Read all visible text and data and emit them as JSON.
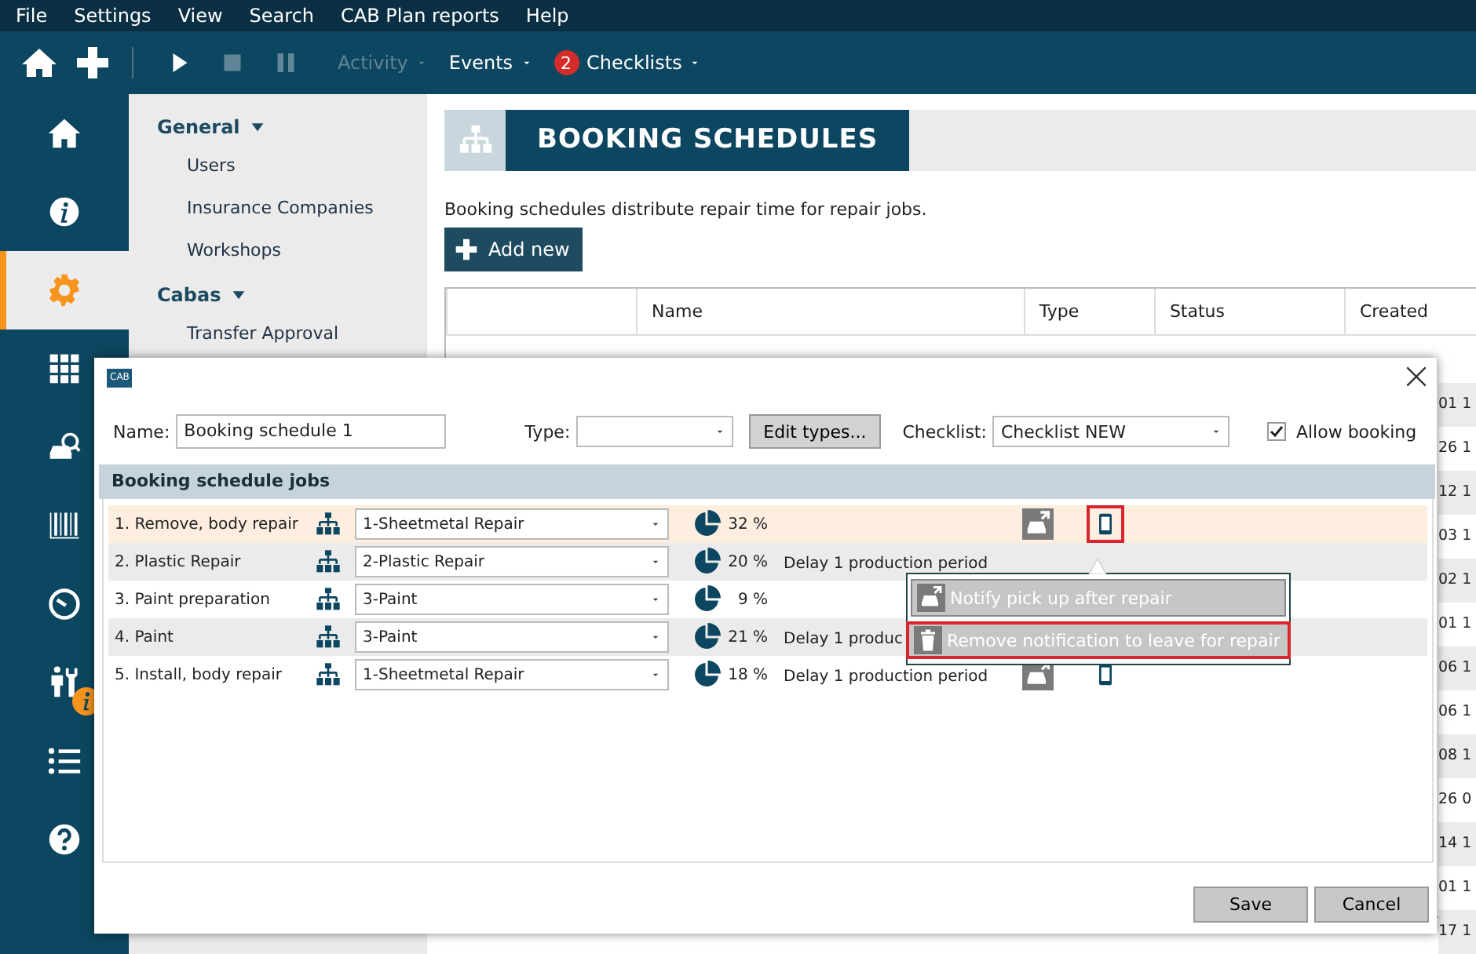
{
  "menu_bar": [
    "File",
    "Settings",
    "View",
    "Search",
    "CAB Plan reports",
    "Help"
  ],
  "toolbar": {
    "actions": [
      {
        "disabled": false
      },
      {
        "disabled": false
      },
      {
        "disabled": false
      },
      {
        "disabled": true
      },
      {
        "disabled": true
      }
    ],
    "menus": [
      {
        "label": "Activity",
        "disabled": true
      },
      {
        "label": "Events",
        "disabled": false
      },
      {
        "label": "Checklists",
        "disabled": false,
        "badge": "2"
      }
    ]
  },
  "sidebar": {
    "items": [
      {
        "selected": false,
        "alert": false
      },
      {
        "selected": false,
        "alert": false
      },
      {
        "selected": true,
        "alert": false
      },
      {
        "selected": false,
        "alert": false
      },
      {
        "selected": false,
        "alert": false
      },
      {
        "selected": false,
        "alert": false
      },
      {
        "selected": false,
        "alert": false
      },
      {
        "selected": false,
        "alert": true
      },
      {
        "selected": false,
        "alert": false
      },
      {
        "selected": false,
        "alert": false
      }
    ]
  },
  "subnav": [
    {
      "title": "General",
      "expanded": true,
      "items": [
        "Users",
        "Insurance Companies",
        "Workshops"
      ]
    },
    {
      "title": "Cabas",
      "expanded": true,
      "items": [
        "Transfer Approval"
      ]
    }
  ],
  "page": {
    "title": "BOOKING SCHEDULES",
    "description": "Booking schedules distribute repair time for repair jobs.",
    "add_button": "Add new",
    "table": {
      "columns": [
        "Name",
        "Type",
        "Status",
        "Created"
      ],
      "rows": [
        {
          "created": "01 1"
        },
        {
          "created": "26 1"
        },
        {
          "created": "12 1"
        },
        {
          "created": "03 1"
        },
        {
          "created": "02 1"
        },
        {
          "created": "01 1"
        },
        {
          "created": "06 1"
        },
        {
          "created": "06 1"
        },
        {
          "created": "08 1"
        },
        {
          "created": "26 0"
        },
        {
          "created": "14 1"
        },
        {
          "created": "01 1"
        },
        {
          "created": "17 1"
        }
      ]
    }
  },
  "dialog": {
    "logo": "CAB",
    "name_label": "Name:",
    "name_value": "Booking schedule 1",
    "type_label": "Type:",
    "edit_types": "Edit types...",
    "checklist_label": "Checklist:",
    "checklist_value": "Checklist NEW",
    "allow_booking": {
      "label": "Allow booking",
      "checked": true
    },
    "section_title": "Booking schedule jobs",
    "jobs": [
      {
        "label": "1. Remove, body repair",
        "department": "1-Sheetmetal Repair",
        "percent": "32 %",
        "selected": true,
        "icons": [
          {
            "kind": "car",
            "marked": false
          },
          {
            "kind": "phone",
            "marked": true
          }
        ]
      },
      {
        "label": "2. Plastic Repair",
        "department": "2-Plastic Repair",
        "percent": "20 %",
        "delay": "Delay 1 production period",
        "selected": false
      },
      {
        "label": "3. Paint preparation",
        "department": "3-Paint",
        "percent": "9 %",
        "selected": false
      },
      {
        "label": "4. Paint",
        "department": "3-Paint",
        "percent": "21 %",
        "delay": "Delay 1 produc",
        "selected": false
      },
      {
        "label": "5. Install, body repair",
        "department": "1-Sheetmetal Repair",
        "percent": "18 %",
        "delay": "Delay 1 production period",
        "selected": false,
        "icons": [
          {
            "kind": "car",
            "marked": false
          },
          {
            "kind": "phone",
            "marked": false
          }
        ]
      }
    ],
    "popup": [
      {
        "label": "Notify pick up after repair",
        "marked": false
      },
      {
        "label": "Remove notification to leave for repair",
        "marked": true
      }
    ],
    "buttons": [
      "Save",
      "Cancel"
    ]
  }
}
